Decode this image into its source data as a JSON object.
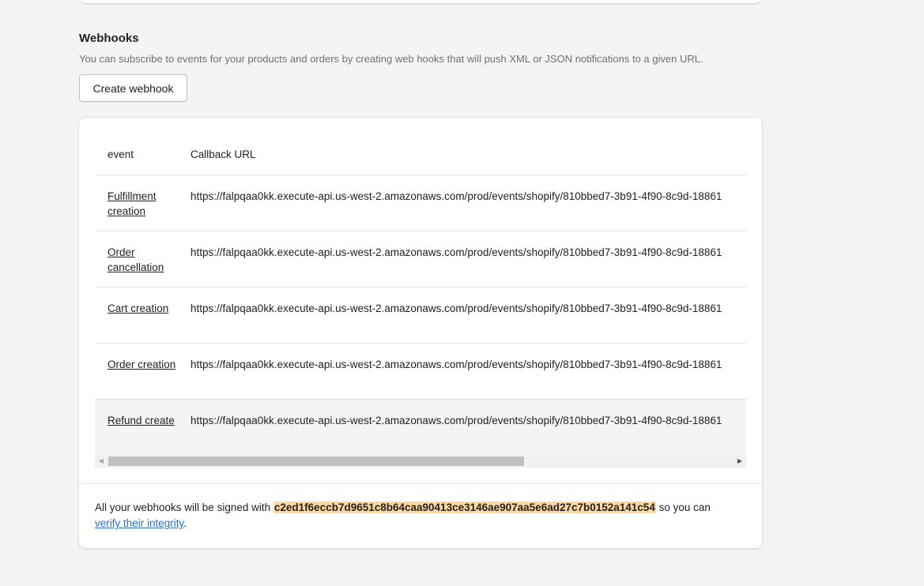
{
  "webhooks": {
    "title": "Webhooks",
    "description": "You can subscribe to events for your products and orders by creating web hooks that will push XML or JSON notifications to a given URL.",
    "create_button": "Create webhook"
  },
  "table": {
    "columns": [
      "event",
      "Callback URL"
    ],
    "rows": [
      {
        "event": "Fulfillment creation",
        "url": "https://falpqaa0kk.execute-api.us-west-2.amazonaws.com/prod/events/shopify/810bbed7-3b91-4f90-8c9d-18861"
      },
      {
        "event": "Order cancellation",
        "url": "https://falpqaa0kk.execute-api.us-west-2.amazonaws.com/prod/events/shopify/810bbed7-3b91-4f90-8c9d-18861"
      },
      {
        "event": "Cart creation",
        "url": "https://falpqaa0kk.execute-api.us-west-2.amazonaws.com/prod/events/shopify/810bbed7-3b91-4f90-8c9d-18861"
      },
      {
        "event": "Order creation",
        "url": "https://falpqaa0kk.execute-api.us-west-2.amazonaws.com/prod/events/shopify/810bbed7-3b91-4f90-8c9d-18861"
      },
      {
        "event": "Refund create",
        "url": "https://falpqaa0kk.execute-api.us-west-2.amazonaws.com/prod/events/shopify/810bbed7-3b91-4f90-8c9d-18861"
      }
    ]
  },
  "footer": {
    "prefix": "All your webhooks will be signed with",
    "hash": "c2ed1f6eccb7d9651c8b64caa90413ce3146ae907aa5e6ad27c7b0152a141c54",
    "suffix": "so you can",
    "link": "verify their integrity",
    "end": "."
  },
  "colors": {
    "hash_highlight": "#ffd79d",
    "link": "#2c6ecb",
    "page_background": "#f4f4f4"
  },
  "icons": {
    "scroll_left": "triangle-left-icon",
    "scroll_right": "triangle-right-icon"
  }
}
